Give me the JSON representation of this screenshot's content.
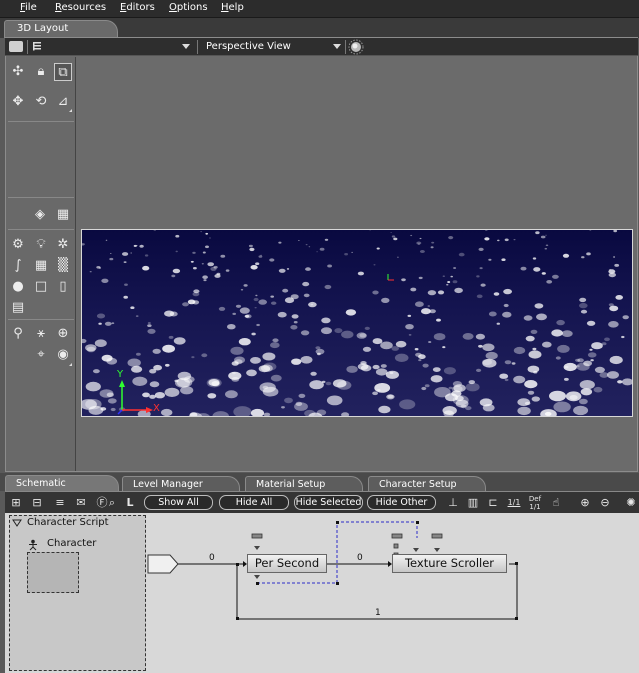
{
  "menu": {
    "items": [
      {
        "first": "F",
        "rest": "ile"
      },
      {
        "first": "R",
        "rest": "esources"
      },
      {
        "first": "E",
        "rest": "ditors"
      },
      {
        "first": "O",
        "rest": "ptions"
      },
      {
        "first": "H",
        "rest": "elp"
      }
    ]
  },
  "layout_tab": "3D Layout",
  "viewbar": {
    "view_mode": "Perspective View"
  },
  "viewport": {
    "axis_y": "Y",
    "axis_x": "X"
  },
  "bottom_tabs": [
    "Schematic",
    "Level Manager",
    "Material Setup",
    "Character Setup"
  ],
  "schematic_toolbar": {
    "L_label": "L",
    "show_all": "Show All",
    "hide_all": "Hide All",
    "hide_selected": "Hide Selected",
    "hide_other": "Hide Other",
    "ratio": "1/1",
    "def_label": "Def",
    "def_ratio": "1/1"
  },
  "schematic": {
    "script_title": "Character Script",
    "character_label": "Character",
    "nodes": [
      "Per Second",
      "Texture Scroller"
    ],
    "wire_labels": [
      "0",
      "0",
      "1"
    ]
  },
  "colors": {
    "menubar": "#2c2c2c",
    "viewport_bg": "#14144f",
    "schematic_bg": "#d8d8d8",
    "selection": "#2b2bc8",
    "axis_x": "#ff3030",
    "axis_y": "#30ff30"
  }
}
